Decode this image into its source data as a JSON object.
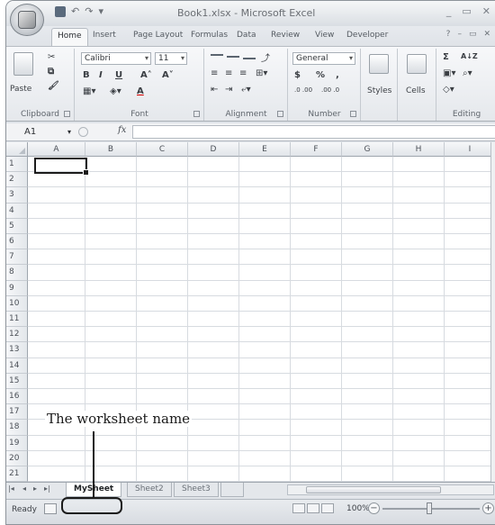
{
  "window": {
    "title": "Book1.xlsx - Microsoft Excel",
    "controls": [
      "_",
      "▭",
      "✕"
    ]
  },
  "quick_access": {
    "undo": "↶",
    "redo": "↷",
    "customize": "▾"
  },
  "ribbon_tabs": [
    {
      "label": "Home",
      "active": true
    },
    {
      "label": "Insert",
      "active": false
    },
    {
      "label": "Page Layout",
      "active": false
    },
    {
      "label": "Formulas",
      "active": false
    },
    {
      "label": "Data",
      "active": false
    },
    {
      "label": "Review",
      "active": false
    },
    {
      "label": "View",
      "active": false
    },
    {
      "label": "Developer",
      "active": false
    }
  ],
  "ribbon_help": {
    "help": "?",
    "minimize": "–",
    "restore": "▭",
    "close": "✕"
  },
  "ribbon": {
    "clipboard": {
      "label": "Clipboard",
      "paste": "Paste"
    },
    "font": {
      "label": "Font",
      "family": "Calibri",
      "size": "11",
      "bold": "B",
      "italic": "I",
      "underline": "U",
      "grow": "A˄",
      "shrink": "A˅",
      "color": "A"
    },
    "alignment": {
      "label": "Alignment"
    },
    "number": {
      "label": "Number",
      "format": "General",
      "currency": "$",
      "percent": "%",
      "comma": ",",
      "inc_decimal": ".0 .00",
      "dec_decimal": ".00 .0"
    },
    "styles": {
      "label": "Styles"
    },
    "cells": {
      "label": "Cells"
    },
    "editing": {
      "label": "Editing",
      "sum": "Σ",
      "sort": "A↓Z"
    }
  },
  "formula_bar": {
    "name_box": "A1",
    "fx": "fx",
    "value": ""
  },
  "grid": {
    "columns": [
      "A",
      "B",
      "C",
      "D",
      "E",
      "F",
      "G",
      "H",
      "I"
    ],
    "rows": [
      "1",
      "2",
      "3",
      "4",
      "5",
      "6",
      "7",
      "8",
      "9",
      "10",
      "11",
      "12",
      "13",
      "14",
      "15",
      "16",
      "17",
      "18",
      "19",
      "20",
      "21"
    ],
    "active_cell": "A1"
  },
  "sheets": [
    {
      "name": "MySheet",
      "active": true
    },
    {
      "name": "Sheet2",
      "active": false
    },
    {
      "name": "Sheet3",
      "active": false
    }
  ],
  "sheet_nav": [
    "|◂",
    "◂",
    "▸",
    "▸|"
  ],
  "status": {
    "state": "Ready",
    "zoom": "100%",
    "zoom_out": "−",
    "zoom_in": "+"
  },
  "annotation": {
    "text": "The worksheet name"
  }
}
